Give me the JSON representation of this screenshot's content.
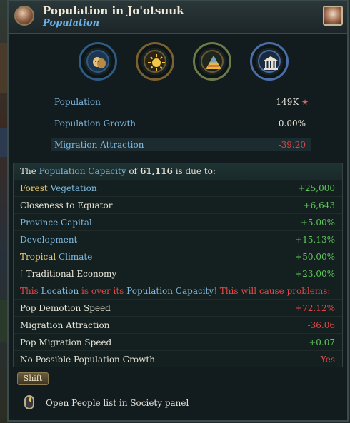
{
  "header": {
    "title": "Population in Jo'otsuuk",
    "subtitle": "Population"
  },
  "icons": [
    "theater-masks-icon",
    "sun-icon",
    "pyramid-icon",
    "temple-icon"
  ],
  "stats": [
    {
      "label": "Population",
      "value": "149K"
    },
    {
      "label": "Population Growth",
      "value": "0.00%"
    },
    {
      "label": "Migration Attraction",
      "value": "-39.20"
    }
  ],
  "capacity": {
    "intro_pre": "The ",
    "intro_link": "Population Capacity",
    "intro_mid": " of ",
    "intro_value": "61,116",
    "intro_post": " is due to:",
    "rows": [
      {
        "k1": "Forest",
        "k2": "Vegetation",
        "v": "+25,000"
      },
      {
        "k1": "Closeness to Equator",
        "v": "+6,643"
      },
      {
        "k1": "Province Capital",
        "v": "+5.00%"
      },
      {
        "k1": "Development",
        "v": "+15.13%"
      },
      {
        "k1": "Tropical",
        "k2": "Climate",
        "v": "+50.00%"
      },
      {
        "k1": "Traditional Economy",
        "v": "+23.00%"
      }
    ],
    "warning": {
      "a": "This ",
      "b": "Location",
      "c": " is over its ",
      "d": "Population Capacity",
      "e": "! This will cause problems:"
    },
    "effects": [
      {
        "k": "Pop Demotion Speed",
        "v": "+72.12%"
      },
      {
        "k": "Migration Attraction",
        "v": "-36.06"
      },
      {
        "k": "Pop Migration Speed",
        "v": "+0.07"
      },
      {
        "k": "No Possible Population Growth",
        "v": "Yes"
      }
    ]
  },
  "shift_label": "Shift",
  "hint": "Open People list in Society panel"
}
